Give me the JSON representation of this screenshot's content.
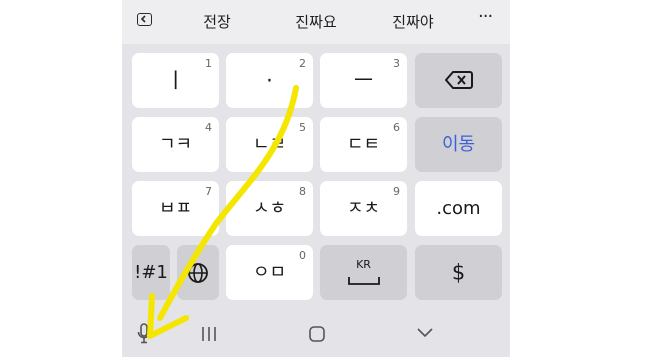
{
  "suggestions": {
    "collapse_icon": "chevron-left-icon",
    "items": [
      "전장",
      "진짜요",
      "진짜야"
    ],
    "more_icon": "more-horizontal-icon",
    "more_label": "···"
  },
  "keys": {
    "row1": [
      {
        "label": "ㅣ",
        "number": "1"
      },
      {
        "label": "·",
        "number": "2"
      },
      {
        "label": "ㅡ",
        "number": "3"
      },
      {
        "label": "",
        "icon": "backspace-icon"
      }
    ],
    "row2": [
      {
        "label": "ㄱㅋ",
        "number": "4"
      },
      {
        "label": "ㄴㄹ",
        "number": "5"
      },
      {
        "label": "ㄷㅌ",
        "number": "6"
      },
      {
        "label": "이동"
      }
    ],
    "row3": [
      {
        "label": "ㅂㅍ",
        "number": "7"
      },
      {
        "label": "ㅅㅎ",
        "number": "8"
      },
      {
        "label": "ㅈㅊ",
        "number": "9"
      },
      {
        "label": ".com"
      }
    ],
    "row4": [
      {
        "label": "!#1"
      },
      {
        "label": "",
        "icon": "globe-icon"
      },
      {
        "label": "ㅇㅁ",
        "number": "0"
      },
      {
        "label": "KR",
        "icon": "space-icon"
      },
      {
        "label": "$"
      }
    ]
  },
  "navigation": {
    "items": [
      "mic-icon",
      "recent-apps-icon",
      "home-icon",
      "back-down-chevron-icon"
    ]
  },
  "colors": {
    "annotation_arrow": "#f5e600",
    "action_text": "#3c62d8",
    "keyboard_bg": "#e3e3e8"
  }
}
